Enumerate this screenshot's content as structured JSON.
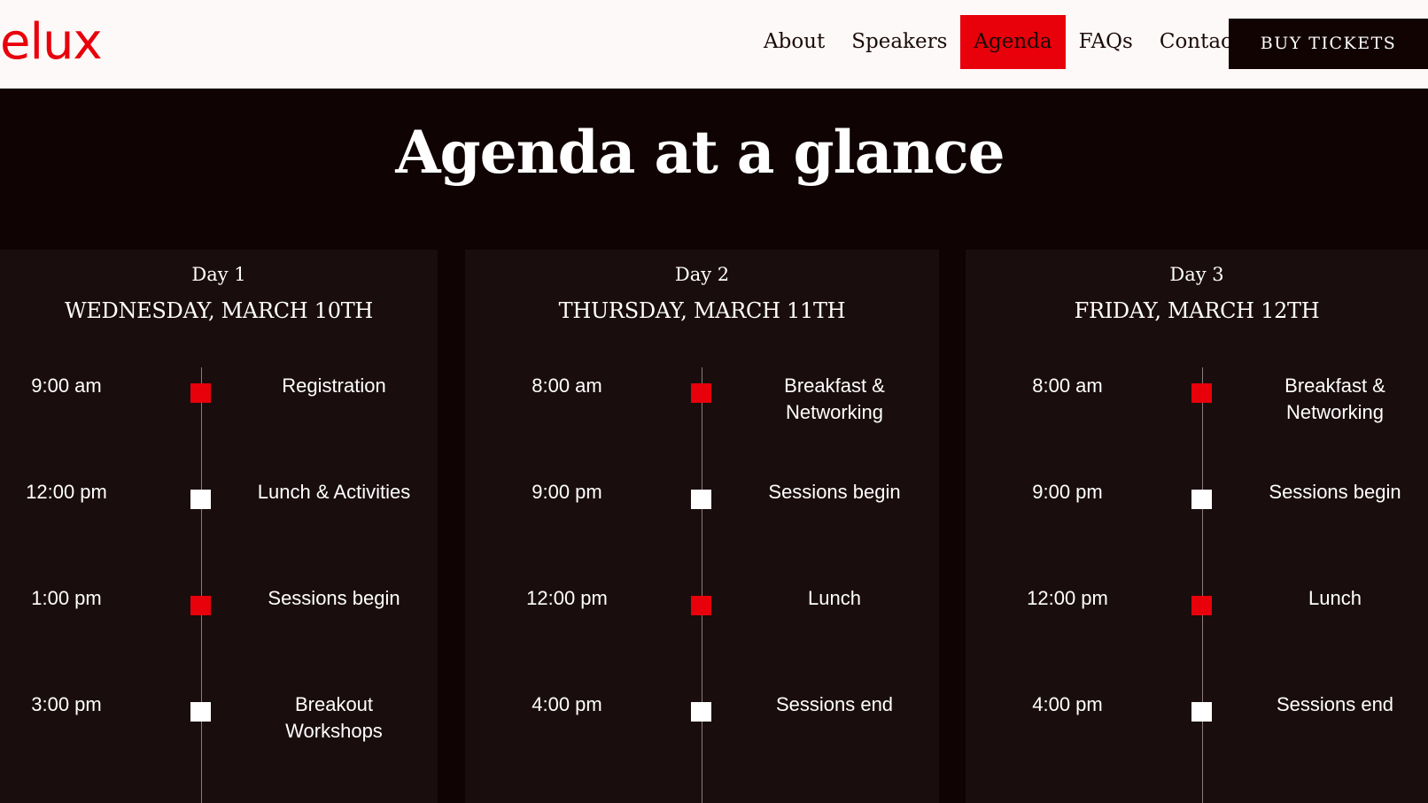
{
  "header": {
    "logo": "elux",
    "nav": [
      "About",
      "Speakers",
      "Agenda",
      "FAQs",
      "Contact"
    ],
    "active_nav": "Agenda",
    "buy_button": "BUY TICKETS"
  },
  "page": {
    "title": "Agenda at a glance"
  },
  "days": [
    {
      "label": "Day 1",
      "date": "WEDNESDAY, MARCH 10TH",
      "items": [
        {
          "time": "9:00 am",
          "event": "Registration",
          "marker": "red"
        },
        {
          "time": "12:00 pm",
          "event": "Lunch & Activities",
          "marker": "white"
        },
        {
          "time": "1:00 pm",
          "event": "Sessions begin",
          "marker": "red"
        },
        {
          "time": "3:00 pm",
          "event": "Breakout Workshops",
          "marker": "white"
        }
      ]
    },
    {
      "label": "Day 2",
      "date": "THURSDAY, MARCH 11TH",
      "items": [
        {
          "time": "8:00 am",
          "event": "Breakfast & Networking",
          "marker": "red"
        },
        {
          "time": "9:00 pm",
          "event": "Sessions begin",
          "marker": "white"
        },
        {
          "time": "12:00 pm",
          "event": "Lunch",
          "marker": "red"
        },
        {
          "time": "4:00 pm",
          "event": "Sessions end",
          "marker": "white"
        }
      ]
    },
    {
      "label": "Day 3",
      "date": "FRIDAY, MARCH 12TH",
      "items": [
        {
          "time": "8:00 am",
          "event": "Breakfast & Networking",
          "marker": "red"
        },
        {
          "time": "9:00 pm",
          "event": "Sessions begin",
          "marker": "white"
        },
        {
          "time": "12:00 pm",
          "event": "Lunch",
          "marker": "red"
        },
        {
          "time": "4:00 pm",
          "event": "Sessions end",
          "marker": "white"
        }
      ]
    }
  ],
  "colors": {
    "accent": "#e8000b",
    "background": "#0f0303",
    "card": "#1a0d0d",
    "header_bg": "#fdf9f8"
  }
}
